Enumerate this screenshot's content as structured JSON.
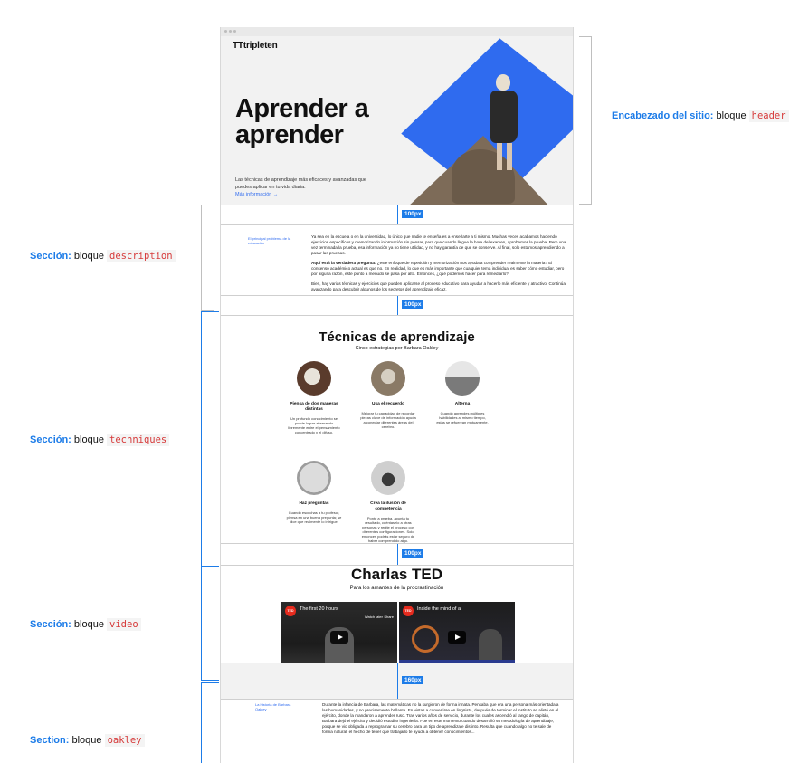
{
  "site": {
    "logo": "tripleten",
    "hero_title": "Aprender a aprender",
    "hero_sub": "Las técnicas de aprendizaje más eficaces y avanzadas que puedes aplicar en tu vida diaria.",
    "hero_link": "Más información →"
  },
  "gaps": {
    "g1": "100px",
    "g2": "100px",
    "g3": "100px",
    "g4": "160px"
  },
  "description": {
    "label": "El principal problema de la educación",
    "p1": "Ya sea en la escuela o en la universidad, lo único que nadie te enseña es a enseñarte a ti mismo. Muchas veces acabamos haciendo ejercicios específicos y memorizando información sin pensar, para que cuando llegue la hora del examen, aprobemos la prueba. Pero una vez terminada la prueba, esa información ya no tiene utilidad, y no hay garantía de que se conserve. Al final, solo estamos aprendiendo a pasar las pruebas.",
    "p2_bold": "Aquí está la verdadera pregunta:",
    "p2": " ¿este enfoque de repetición y memorización nos ayuda a comprender realmente la materia? El consenso académico actual es que no. En realidad, lo que es más importante que cualquier tema individual es saber cómo estudiar, pero por alguna razón, este punto a menudo se pasa por alto. Entonces, ¿qué podemos hacer para remediarlo?",
    "p3": "Bien, hay varias técnicas y ejercicios que pueden aplicarse al proceso educativo para ayudar a hacerlo más eficiente y atractivo. Continúa avanzando para descubrir algunos de los secretos del aprendizaje eficaz."
  },
  "techniques": {
    "title": "Técnicas de aprendizaje",
    "subtitle": "Cinco estrategias por Barbara Oakley",
    "items": [
      {
        "title": "Piensa de dos maneras distintas",
        "desc": "Un profundo conocimiento se puede lograr alternando libremente entre el pensamiento concentrado y el difuso."
      },
      {
        "title": "Usa el recuerdo",
        "desc": "Mejorar tu capacidad de recordar piezas clave de información ayuda a conectar diferentes áreas del cerebro."
      },
      {
        "title": "Alterna",
        "desc": "Cuando aprendes múltiples habilidades al mismo tiempo, estas se refuerzan mutuamente."
      },
      {
        "title": "Haz preguntas",
        "desc": "Cuando escuchas a tu profesor, piensa en una buena pregunta; se dice que realmente lo intrigue."
      },
      {
        "title": "Crea la ilusión de competencia",
        "desc": "Ponte a prueba, apunta tu resultado, cuéntaselo a otras personas y repite el proceso con diferentes configuraciones. Solo entonces podrás estar seguro de haber comprendido algo."
      }
    ]
  },
  "video": {
    "title": "Charlas TED",
    "subtitle": "Para los amantes de la procrastinación",
    "thumb1_title": "The first 20 hours",
    "thumb2_title": "Inside the mind of a",
    "watch_later": "Watch later",
    "share": "Share"
  },
  "oakley": {
    "label": "La historia de Barbara Oakley",
    "text": "Durante la infancia de Barbara, las matemáticas no la surgieron de forma innata. Pensaba que era una persona más orientada a las humanidades, y no precisamente brillante. En vistas a convertirse en lingüista, después de terminar el instituto se alistó en el ejército, donde la mandaron a aprender ruso. Tras varios años de servicio, durante los cuales ascendió al rango de capitán, Barbara dejó el ejército y decidió estudiar ingeniería. Fue en este momento cuando desarrolló su metodología de aprendizaje, porque se vio obligada a reprogramar su cerebro para un tipo de aprendizaje distinto. Resulta que cuando algo no te sale de forma natural, el hecho de tener que trabajarlo te ayuda a obtener conocimientos..."
  },
  "annotations": {
    "header_label": "Encabezado del sitio:",
    "header_block": "bloque",
    "header_code": "header",
    "desc_label": "Sección:",
    "desc_block": "bloque",
    "desc_code": "description",
    "tech_label": "Sección:",
    "tech_block": "bloque",
    "tech_code": "techniques",
    "video_label": "Sección:",
    "video_block": "bloque",
    "video_code": "video",
    "oak_label": "Section:",
    "oak_block": "bloque",
    "oak_code": "oakley"
  }
}
